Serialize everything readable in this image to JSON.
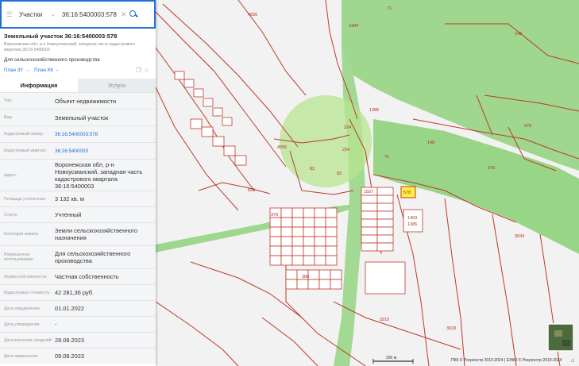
{
  "search": {
    "layer": "Участки",
    "query": "36:16:5400003:578"
  },
  "parcel": {
    "title": "Земельный участок 36:16:5400003:578",
    "address_short": "Воронежская обл, р-н Новоусманский, западная часть кадастрового квартала 36:16:5400003",
    "purpose": "Для сельскохозяйственного производства",
    "link_plan_zu": "План ЗУ →",
    "link_plan_kk": "План КК →"
  },
  "tabs": {
    "info": "Информация",
    "services": "Услуги"
  },
  "rows": [
    {
      "label": "Тип:",
      "value": "Объект недвижимости"
    },
    {
      "label": "Вид:",
      "value": "Земельный участок"
    },
    {
      "label": "Кадастровый номер:",
      "value": "36:16:5400003:578"
    },
    {
      "label": "Кадастровый квартал:",
      "value": "36:16:5400003"
    },
    {
      "label": "Адрес:",
      "value": "Воронежская обл, р-н Новоусманский, западная часть кадастрового квартала 36:16:5400003"
    },
    {
      "label": "Площадь уточненная:",
      "value": "3 132 кв. м"
    },
    {
      "label": "Статус:",
      "value": "Учтенный"
    },
    {
      "label": "Категория земель:",
      "value": "Земли сельскохозяйственного назначения"
    },
    {
      "label": "Разрешенное использование:",
      "value": "Для сельскохозяйственного производства"
    },
    {
      "label": "Форма собственности:",
      "value": "Частная собственность"
    },
    {
      "label": "Кадастровая стоимость:",
      "value": "42 281,36 руб."
    },
    {
      "label": "Дата определения:",
      "value": "01.01.2022"
    },
    {
      "label": "Дата утверждения:",
      "value": "-"
    },
    {
      "label": "Дата внесения сведений:",
      "value": "28.08.2023"
    },
    {
      "label": "Дата применения:",
      "value": "09.08.2023"
    }
  ],
  "map": {
    "labels": {
      "n4555a": "4555",
      "n71": "71",
      "n1384": "1384",
      "n148": "148",
      "n1385": "1385",
      "n224": "224",
      "n234": "234",
      "n4555b": "4555",
      "n83": "83",
      "n82": "82",
      "n71b": "71",
      "n148b": "148",
      "n976": "976",
      "n976b": "976",
      "n626": "626",
      "n1557": "1557",
      "n578": "578",
      "n3034": "3034",
      "n1403": "1403",
      "n1386": "1386",
      "n3210": "3210",
      "n3033": "3033",
      "n379": "379",
      "n386": "386"
    },
    "scale_label": "200 м",
    "copyright": "ПКК © Росреестр 2010-2024 | ЕЭКО © Росреестр 2019-2024",
    "colors": {
      "background": "#f2f2f2",
      "forest": "#8fd27b",
      "boundary": "#c0392b",
      "highlight": "#ffee44",
      "panel_accent": "#1e6fd9"
    }
  }
}
